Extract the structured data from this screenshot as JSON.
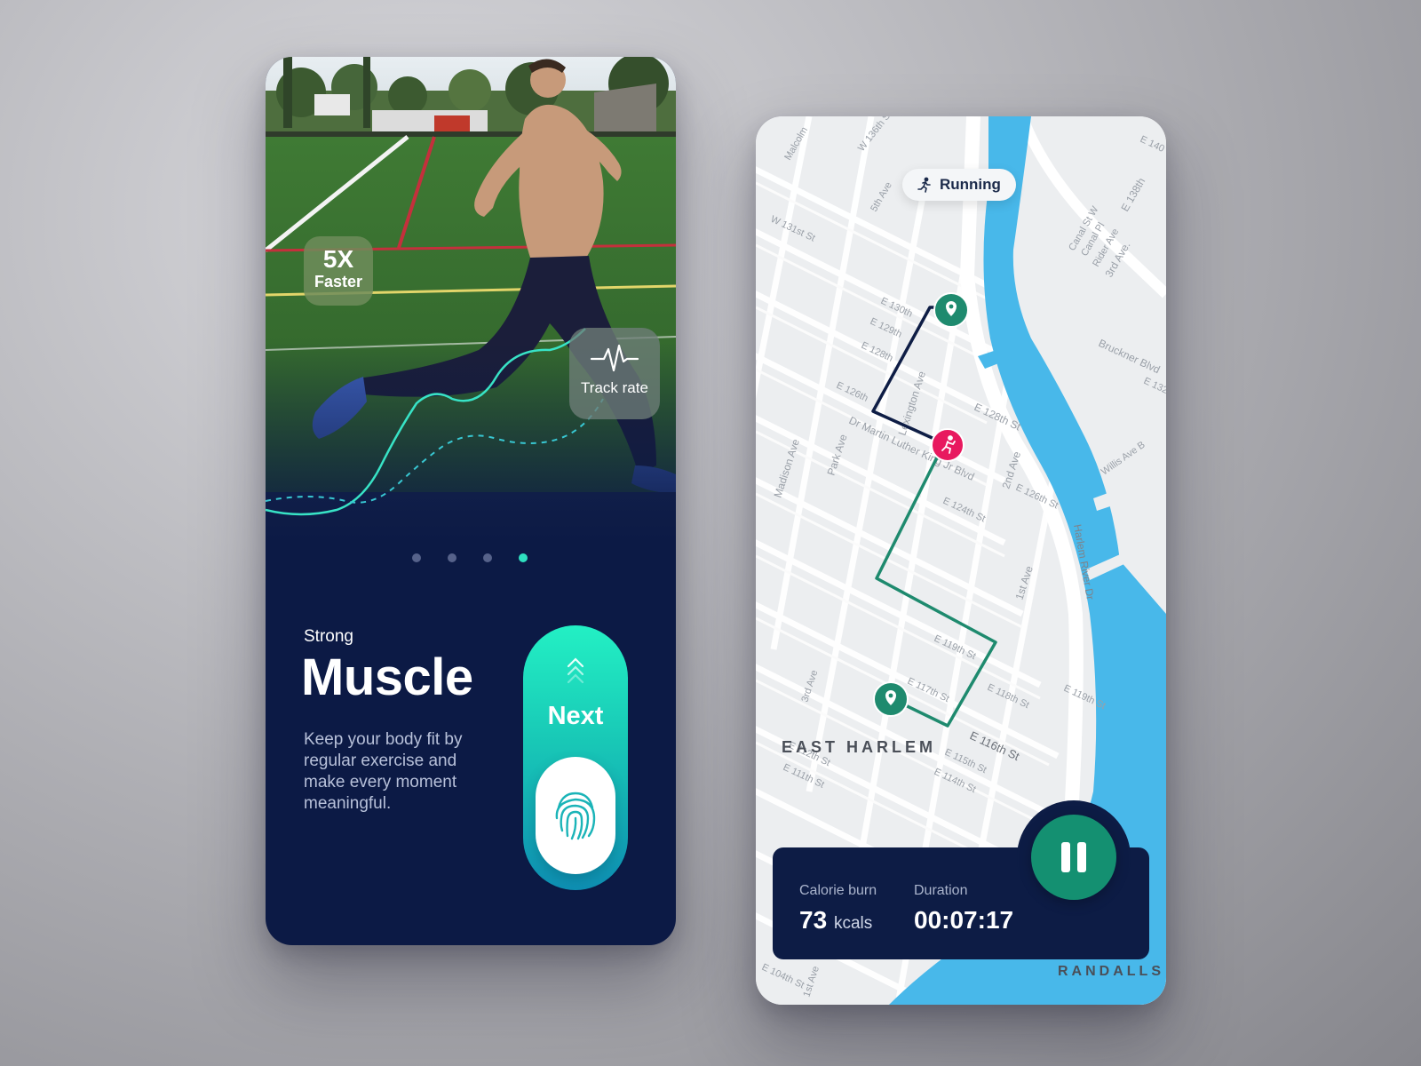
{
  "onboarding": {
    "badge_speed": {
      "value": "5X",
      "label": "Faster"
    },
    "badge_track": {
      "label": "Track rate",
      "icon": "heartbeat-icon"
    },
    "pagination": {
      "count": 4,
      "active_index": 3
    },
    "subtitle": "Strong",
    "title": "Muscle",
    "description": "Keep your body fit by regular exercise and make every moment meaningful.",
    "next_button": {
      "label": "Next",
      "icon": "chevron-up-icon"
    },
    "fingerprint": {
      "icon": "fingerprint-icon"
    }
  },
  "tracker": {
    "activity_chip": {
      "label": "Running",
      "icon": "runner-icon"
    },
    "map_labels": {
      "area": "EAST HARLEM",
      "area2": "RANDALLS",
      "streets": [
        "Malcolm",
        "W 136th St",
        "5th Ave",
        "W 131st St",
        "E 130th",
        "E 129th",
        "E 128th",
        "E 126th",
        "Dr Martin Luther King Jr Blvd",
        "Park Ave",
        "Madison Ave",
        "Lexington Ave",
        "E 128th St",
        "2nd Ave",
        "E 126th St",
        "E 124th St",
        "1st Ave",
        "E 119th St",
        "E 118th St",
        "E 117th St",
        "E 116th St",
        "E 115th St",
        "E 114th St",
        "E 112th St",
        "E 111th St",
        "3rd Ave",
        "Harlem River Dr",
        "Bruckner Blvd",
        "Willis Ave B",
        "E 138th",
        "Canal St W",
        "Canal Pl",
        "Rider Ave",
        "3rd Ave.",
        "E 140",
        "E 132",
        "E 119th St",
        "E 104th St",
        "1st Ave"
      ]
    },
    "stats": {
      "calorie_label": "Calorie burn",
      "calorie_value": "73",
      "calorie_unit": "kcals",
      "duration_label": "Duration",
      "duration_value": "00:07:17"
    },
    "pause_button": {
      "icon": "pause-icon"
    },
    "colors": {
      "route_start": "#0e1d45",
      "route_done": "#1e8a6e",
      "marker": "#1e8a6e",
      "runner": "#e8195f",
      "river": "#48b8ea"
    }
  }
}
